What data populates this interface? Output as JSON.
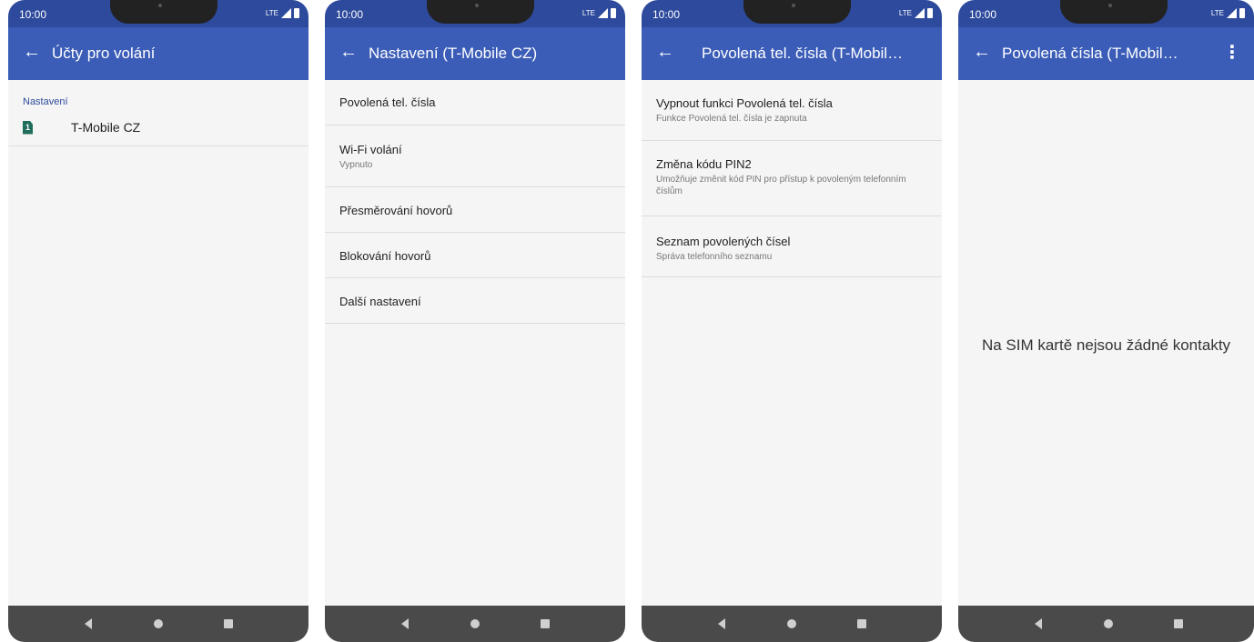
{
  "status_bar": {
    "time": "10:00",
    "network": "LTE"
  },
  "screens": [
    {
      "title": "Účty pro volání",
      "section_header": "Nastavení",
      "account": {
        "sim_number": "1",
        "label": "T-Mobile CZ"
      }
    },
    {
      "title": "Nastavení (T-Mobile CZ)",
      "items": [
        {
          "title": "Povolená tel. čísla"
        },
        {
          "title": "Wi-Fi volání",
          "subtitle": "Vypnuto"
        },
        {
          "title": "Přesměrování hovorů"
        },
        {
          "title": "Blokování hovorů"
        },
        {
          "title": "Další nastavení"
        }
      ]
    },
    {
      "title": "Povolená tel. čísla (T-Mobil…",
      "items": [
        {
          "title": "Vypnout funkci Povolená tel. čísla",
          "subtitle": "Funkce Povolená tel. čísla je zapnuta"
        },
        {
          "title": "Změna kódu PIN2",
          "subtitle": "Umožňuje změnit kód PIN pro přístup k povoleným telefonním číslům"
        },
        {
          "title": "Seznam povolených čísel",
          "subtitle": "Správa telefonního seznamu"
        }
      ]
    },
    {
      "title": "Povolená čísla (T-Mobil…",
      "empty_message": "Na SIM kartě nejsou žádné kontakty"
    }
  ],
  "icons": {
    "back": "arrow-left-icon",
    "more": "more-vert-icon",
    "sim": "sim-card-icon",
    "nav_back": "triangle-back-icon",
    "nav_home": "circle-home-icon",
    "nav_recent": "square-recents-icon"
  },
  "colors": {
    "app_bar": "#3b5db8",
    "status_bar": "#2d4a9c",
    "accent": "#2d4a9c",
    "nav_bar": "#4a4a4a"
  }
}
